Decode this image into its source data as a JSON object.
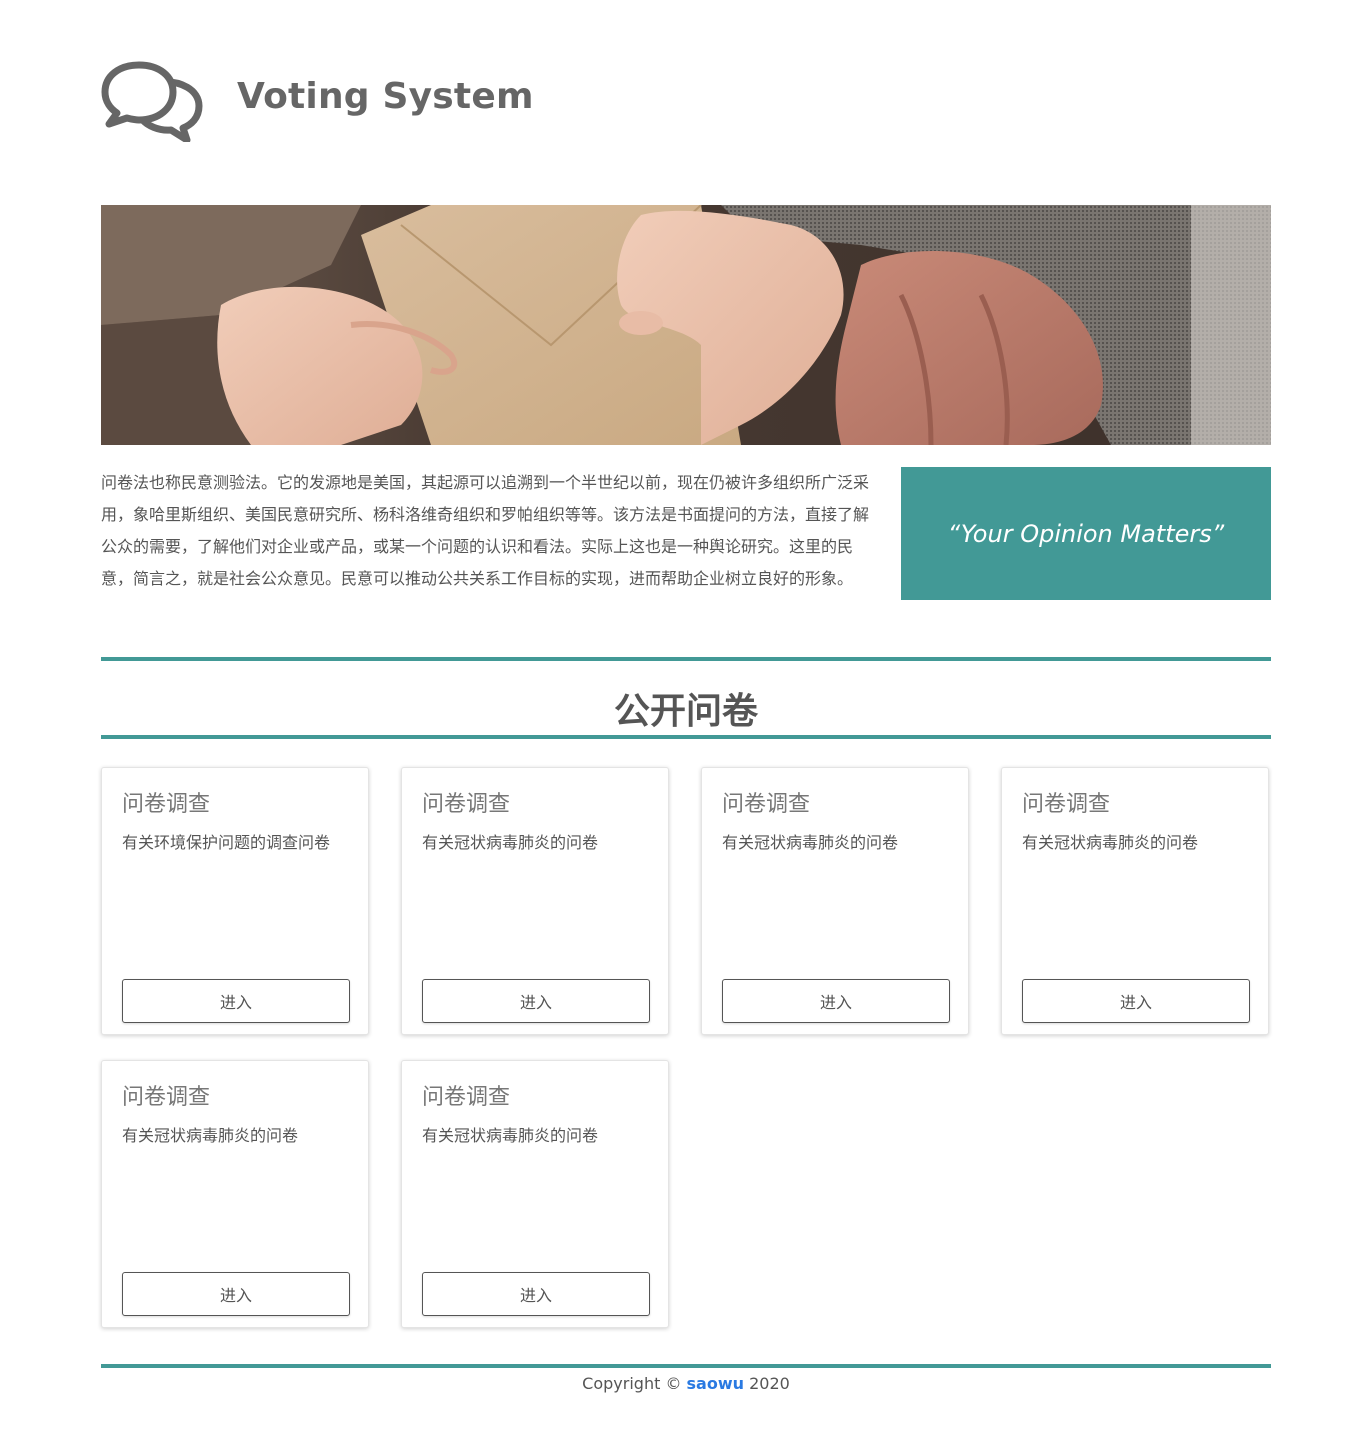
{
  "header": {
    "title": "Voting System",
    "logo_icon": "chat-bubbles-icon"
  },
  "hero": {
    "image": "hands-passing-envelope-photo"
  },
  "intro": {
    "text": "问卷法也称民意测验法。它的发源地是美国，其起源可以追溯到一个半世纪以前，现在仍被许多组织所广泛采用，象哈里斯组织、美国民意研究所、杨科洛维奇组织和罗帕组织等等。该方法是书面提问的方法，直接了解公众的需要，了解他们对企业或产品，或某一个问题的认识和看法。实际上这也是一种舆论研究。这里的民意，简言之，就是社会公众意见。民意可以推动公共关系工作目标的实现，进而帮助企业树立良好的形象。",
    "quote": "“Your Opinion Matters”"
  },
  "section": {
    "title": "公开问卷"
  },
  "surveys": [
    {
      "title": "问卷调查",
      "description": "有关环境保护问题的调查问卷",
      "button": "进入"
    },
    {
      "title": "问卷调查",
      "description": "有关冠状病毒肺炎的问卷",
      "button": "进入"
    },
    {
      "title": "问卷调查",
      "description": "有关冠状病毒肺炎的问卷",
      "button": "进入"
    },
    {
      "title": "问卷调查",
      "description": "有关冠状病毒肺炎的问卷",
      "button": "进入"
    },
    {
      "title": "问卷调查",
      "description": "有关冠状病毒肺炎的问卷",
      "button": "进入"
    },
    {
      "title": "问卷调查",
      "description": "有关冠状病毒肺炎的问卷",
      "button": "进入"
    }
  ],
  "footer": {
    "prefix": "Copyright ©",
    "link": "saowu",
    "year": "2020"
  },
  "colors": {
    "accent": "#429996",
    "link": "#2a7ae2",
    "text": "#555555"
  }
}
